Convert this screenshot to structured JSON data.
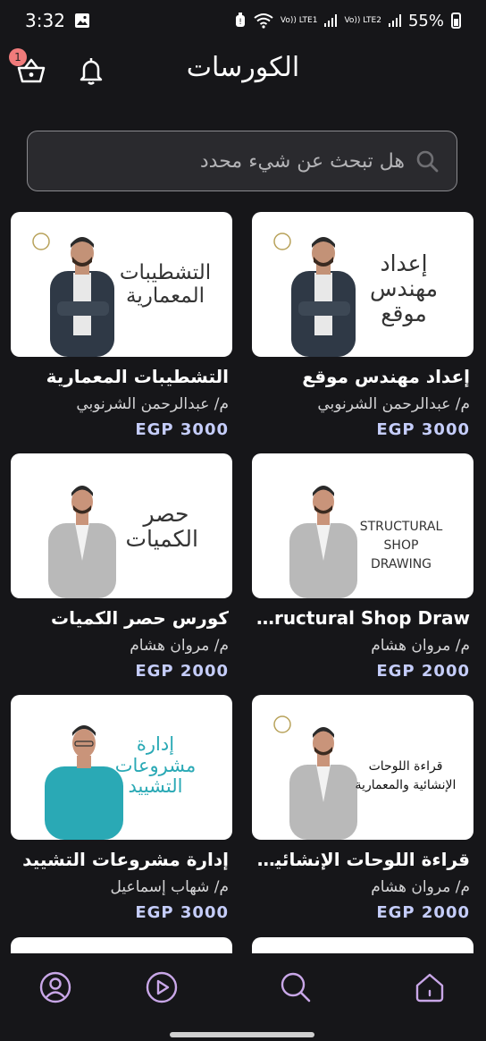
{
  "status": {
    "time": "3:32",
    "carrier1": "Vo)) LTE1",
    "carrier2": "Vo)) LTE2",
    "battery": "55%"
  },
  "header": {
    "title": "الكورسات",
    "cart_count": "1"
  },
  "search": {
    "placeholder": "هل تبحث عن شيء محدد"
  },
  "courses": [
    {
      "thumb_text": "إعداد مهندس موقع",
      "title": "إعداد مهندس موقع",
      "instructor": "م/ عبدالرحمن الشرنوبي",
      "price": "EGP 3000"
    },
    {
      "thumb_text": "التشطيبات المعمارية",
      "title": "التشطيبات المعمارية",
      "instructor": "م/ عبدالرحمن الشرنوبي",
      "price": "EGP 3000"
    },
    {
      "thumb_text": "STRUCTURAL SHOP DRAWING",
      "title": "Structural Shop Draw...",
      "instructor": "م/ مروان هشام",
      "price": "EGP 2000"
    },
    {
      "thumb_text": "حصر الكميات",
      "title": "كورس حصر الكميات",
      "instructor": "م/ مروان هشام",
      "price": "EGP 2000"
    },
    {
      "thumb_text": "قراءة اللوحات الإنشائية والمعمارية",
      "title": "قراءة اللوحات الإنشائية ...",
      "instructor": "م/ مروان هشام",
      "price": "EGP 2000"
    },
    {
      "thumb_text": "إدارة مشروعات التشييد",
      "title": "إدارة مشروعات التشييد",
      "instructor": "م/ شهاب إسماعيل",
      "price": "EGP 3000"
    }
  ],
  "nav": {
    "items": [
      "home-icon",
      "search-icon",
      "play-icon",
      "profile-icon"
    ],
    "active": "search-icon",
    "accent": "#c9a7e8"
  }
}
